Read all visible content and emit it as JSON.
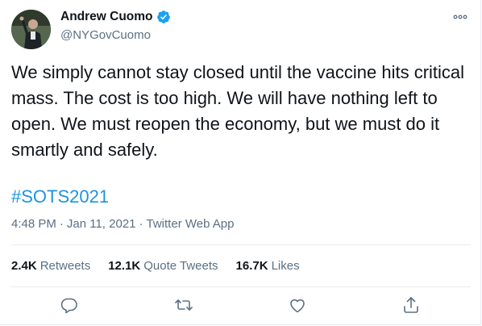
{
  "author": {
    "name": "Andrew Cuomo",
    "handle": "@NYGovCuomo"
  },
  "tweet": {
    "text": "We simply cannot stay closed until the vaccine hits critical mass. The cost is too high. We will have nothing left to open. We must reopen the economy, but we must do it smartly and safely.",
    "hashtag": "#SOTS2021",
    "time": "4:48 PM",
    "separator": "·",
    "date": "Jan 11, 2021",
    "app": "Twitter Web App"
  },
  "stats": {
    "retweets_count": "2.4K",
    "retweets_label": "Retweets",
    "quotes_count": "12.1K",
    "quotes_label": "Quote Tweets",
    "likes_count": "16.7K",
    "likes_label": "Likes"
  },
  "icons": {
    "verified": "verified-badge-icon",
    "more": "more-options-icon",
    "reply": "reply-icon",
    "retweet": "retweet-icon",
    "like": "like-icon",
    "share": "share-icon"
  },
  "colors": {
    "accent": "#1b95e0",
    "text": "#0f1419",
    "secondary": "#5b7083",
    "border": "#e6ecf0"
  }
}
